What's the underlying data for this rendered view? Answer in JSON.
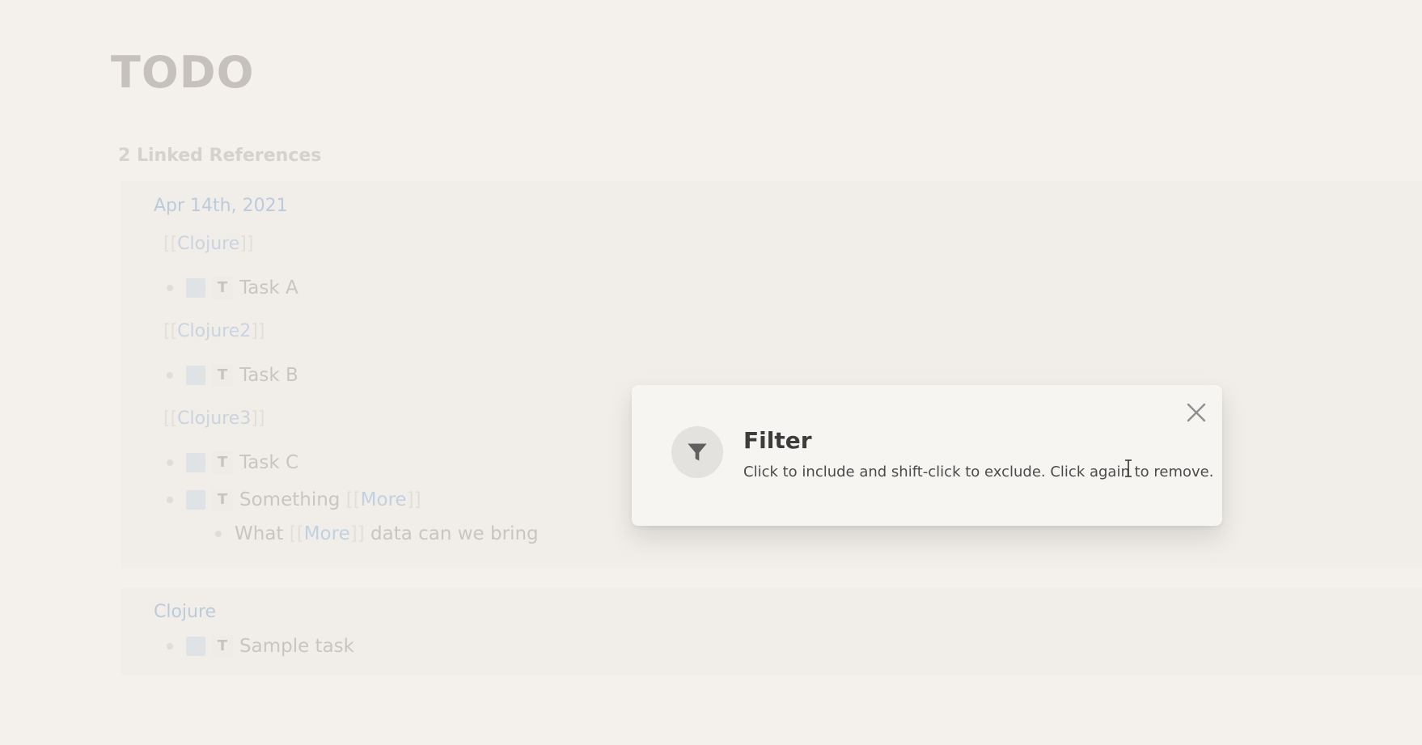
{
  "page": {
    "title": "TODO"
  },
  "references": {
    "heading": "2 Linked References",
    "cards": [
      {
        "date": "Apr 14th, 2021",
        "groups": [
          {
            "link": "Clojure",
            "blocks": [
              {
                "marker": "T",
                "text": "Task A"
              }
            ]
          },
          {
            "link": "Clojure2",
            "blocks": [
              {
                "marker": "T",
                "text": "Task B"
              }
            ]
          },
          {
            "link": "Clojure3",
            "blocks": [
              {
                "marker": "T",
                "text": "Task C"
              },
              {
                "marker": "T",
                "text": "Something",
                "link": "More"
              }
            ],
            "child": {
              "before": "What",
              "link": "More",
              "after": "data can we bring"
            }
          }
        ]
      },
      {
        "title": "Clojure",
        "blocks": [
          {
            "marker": "T",
            "text": "Sample task"
          }
        ]
      }
    ]
  },
  "brackets": {
    "open": "[[",
    "close": "]]"
  },
  "filter_modal": {
    "title": "Filter",
    "description": "Click to include and shift-click to exclude. Click again to remove.",
    "icon": "filter-icon",
    "close_icon": "close-icon"
  },
  "colors": {
    "background": "#f4f1ec",
    "modal_background": "#f6f5f2",
    "link": "#bccbdc"
  }
}
